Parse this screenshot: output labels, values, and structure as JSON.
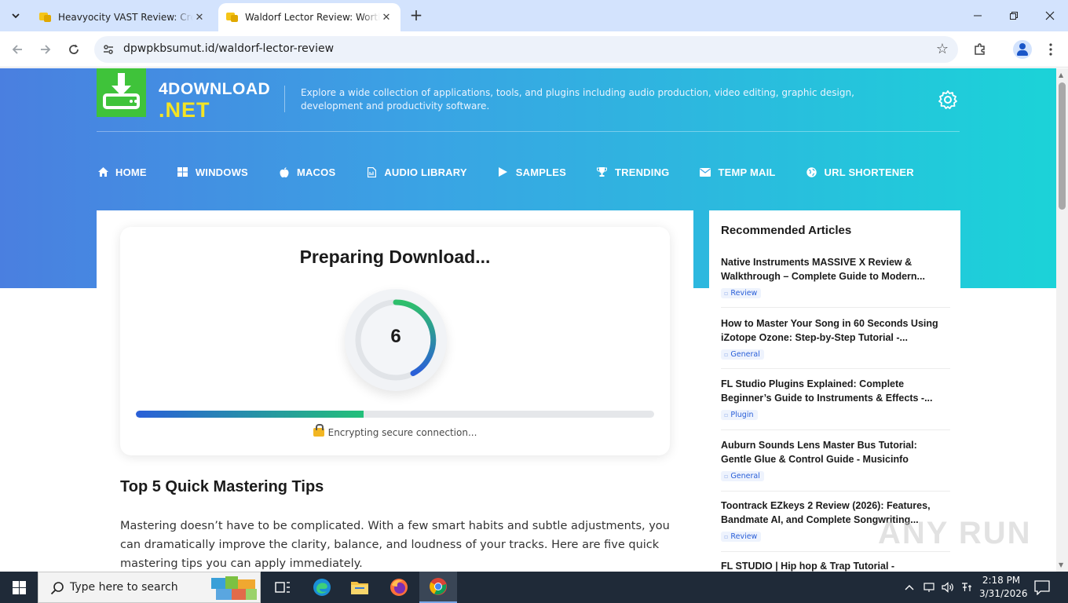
{
  "browser": {
    "tabs": [
      {
        "title": "Heavyocity VAST Review: Creati",
        "active": false
      },
      {
        "title": "Waldorf Lector Review: Worth It",
        "active": true
      }
    ],
    "url": "dpwpkbsumut.id/waldorf-lector-review"
  },
  "site": {
    "logo_line1": "4DOWNLOAD",
    "logo_line2": ".NET",
    "tagline": "Explore a wide collection of applications, tools, and plugins including audio production, video editing, graphic design, development and productivity software.",
    "nav": [
      {
        "label": "HOME",
        "icon": "home-icon"
      },
      {
        "label": "WINDOWS",
        "icon": "windows-icon"
      },
      {
        "label": "MACOS",
        "icon": "apple-icon"
      },
      {
        "label": "AUDIO LIBRARY",
        "icon": "audio-file-icon"
      },
      {
        "label": "SAMPLES",
        "icon": "play-icon"
      },
      {
        "label": "TRENDING",
        "icon": "trophy-icon"
      },
      {
        "label": "TEMP MAIL",
        "icon": "envelope-icon"
      },
      {
        "label": "URL SHORTENER",
        "icon": "globe-icon"
      }
    ]
  },
  "download": {
    "title": "Preparing Download...",
    "countdown": "6",
    "progress": 0.44,
    "status": "Encrypting secure connection..."
  },
  "article": {
    "heading": "Top 5 Quick Mastering Tips",
    "paragraph": "Mastering doesn’t have to be complicated. With a few smart habits and subtle adjustments, you can dramatically improve the clarity, balance, and loudness of your tracks. Here are five quick mastering tips you can apply immediately."
  },
  "sidebar": {
    "title": "Recommended Articles",
    "items": [
      {
        "title": "Native Instruments MASSIVE X Review & Walkthrough – Complete Guide to Modern...",
        "tag": "Review"
      },
      {
        "title": "How to Master Your Song in 60 Seconds Using iZotope Ozone: Step-by-Step Tutorial -...",
        "tag": "General"
      },
      {
        "title": "FL Studio Plugins Explained: Complete Beginner’s Guide to Instruments & Effects -...",
        "tag": "Plugin"
      },
      {
        "title": "Auburn Sounds Lens Master Bus Tutorial: Gentle Glue & Control Guide - Musicinfo",
        "tag": "General"
      },
      {
        "title": "Toontrack EZkeys 2 Review (2026): Features, Bandmate AI, and Complete Songwriting...",
        "tag": "Review"
      },
      {
        "title": "FL STUDIO | Hip hop & Trap Tutorial -",
        "tag": ""
      }
    ]
  },
  "watermark": "ANY RUN",
  "taskbar": {
    "search_placeholder": "Type here to search",
    "time": "2:18 PM",
    "date": "3/31/2026"
  }
}
